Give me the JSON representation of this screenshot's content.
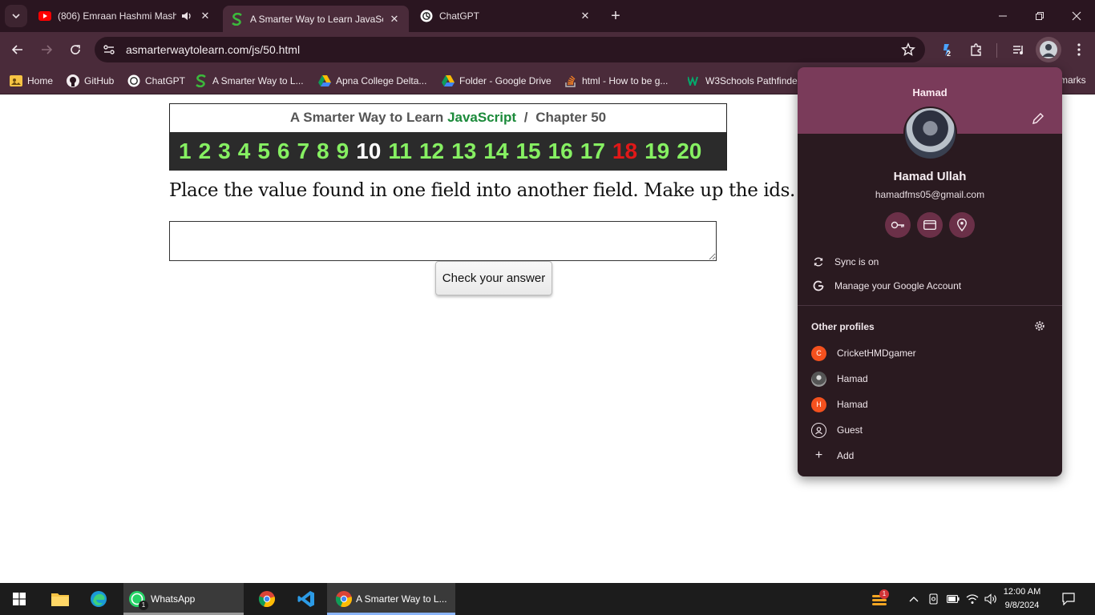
{
  "browser": {
    "tabs": [
      {
        "title": "(806) Emraan Hashmi Mash",
        "icon": "youtube-icon",
        "audio": true
      },
      {
        "title": "A Smarter Way to Learn JavaScr",
        "icon": "smarter-way-icon",
        "active": true
      },
      {
        "title": "ChatGPT",
        "icon": "chatgpt-icon"
      }
    ],
    "url": "asmarterwaytolearn.com/js/50.html",
    "extension_badge": "2",
    "bookmarks": [
      {
        "label": "Home",
        "icon": "folder-icon"
      },
      {
        "label": "GitHub",
        "icon": "github-icon"
      },
      {
        "label": "ChatGPT",
        "icon": "chatgpt-icon"
      },
      {
        "label": "A Smarter Way to L...",
        "icon": "smarter-way-icon"
      },
      {
        "label": "Apna College Delta...",
        "icon": "google-drive-icon"
      },
      {
        "label": "Folder - Google Drive",
        "icon": "google-drive-icon"
      },
      {
        "label": "html - How to be g...",
        "icon": "stackoverflow-icon"
      },
      {
        "label": "W3Schools Pathfinder",
        "icon": "w3schools-icon"
      }
    ],
    "bookmarks_overflow": "marks"
  },
  "page": {
    "header_prefix": "A Smarter Way to Learn",
    "header_brand": "JavaScript",
    "header_sep": "/",
    "header_chapter": "Chapter 50",
    "chapters": [
      "1",
      "2",
      "3",
      "4",
      "5",
      "6",
      "7",
      "8",
      "9",
      "10",
      "11",
      "12",
      "13",
      "14",
      "15",
      "16",
      "17",
      "18",
      "19",
      "20"
    ],
    "current_chapter": "10",
    "red_chapter": "18",
    "instruction": "Place the value found in one field into another field. Make up the ids.",
    "answer_value": "",
    "check_button": "Check your answer",
    "colors": {
      "chapter_link": "#86f062",
      "chapter_current": "#ffffff",
      "chapter_red": "#e01818",
      "brand_green": "#1b8a3a"
    }
  },
  "profile_menu": {
    "header_name": "Hamad",
    "full_name": "Hamad Ullah",
    "email": "hamadfms05@gmail.com",
    "sync_label": "Sync is on",
    "manage_label": "Manage your Google Account",
    "other_profiles_label": "Other profiles",
    "profiles": [
      {
        "name": "CricketHMDgamer",
        "initial": "C",
        "color": "#f4511e"
      },
      {
        "name": "Hamad",
        "initial": "",
        "color": "#5a5a5a"
      },
      {
        "name": "Hamad",
        "initial": "H",
        "color": "#f4511e"
      }
    ],
    "guest_label": "Guest",
    "add_label": "Add",
    "colors": {
      "header": "#7a3b5a",
      "background": "#2a1a20"
    }
  },
  "taskbar": {
    "whatsapp_label": "WhatsApp",
    "whatsapp_badge": "1",
    "chrome_window_label": "A Smarter Way to L...",
    "weather_badge": "1",
    "time": "12:00 AM",
    "date": "9/8/2024"
  }
}
